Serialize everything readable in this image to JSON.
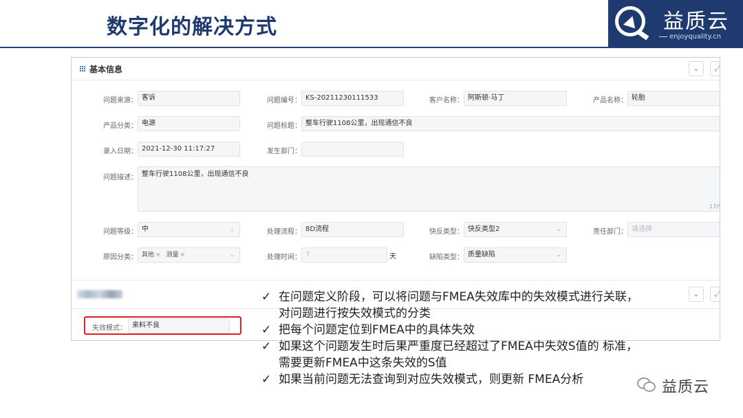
{
  "slide": {
    "title": "数字化的解决方式"
  },
  "logo": {
    "name": "益质云",
    "url_text": "enjoyquality.cn"
  },
  "panel": {
    "title": "基本信息",
    "fields": {
      "source_label": "问题来源：",
      "source_value": "客诉",
      "number_label": "问题编号：",
      "number_value": "KS-20211230111533",
      "customer_label": "客户名称：",
      "customer_value": "阿斯顿·马丁",
      "product_label": "产品名称：",
      "product_value": "轮胎",
      "category_label": "产品分类：",
      "category_value": "电源",
      "issue_title_label": "问题标题：",
      "issue_title_value": "整车行驶1108公里，出现通信不良",
      "entry_date_label": "录入日期：",
      "entry_date_value": "2021-12-30 11:17:27",
      "dept_label": "发生部门：",
      "dept_value": "",
      "desc_label": "问题描述：",
      "desc_value": "整车行驶1108公里，出现通信不良",
      "desc_counter": "17/5",
      "level_label": "问题等级：",
      "level_value": "中",
      "process_label": "处理流程：",
      "process_value": "8D流程",
      "quick_label": "快反类型：",
      "quick_value": "快反类型2",
      "owner_label": "责任部门：",
      "owner_placeholder": "请选择",
      "cause_label": "原因分类：",
      "cause_tags": [
        "其他",
        "测量"
      ],
      "time_label": "处理时间：",
      "time_value": "7",
      "time_unit": "天",
      "defect_label": "缺陷类型：",
      "defect_value": "质量缺陷"
    },
    "failure": {
      "label": "失效模式：",
      "value": "来料不良"
    }
  },
  "bullets": [
    {
      "mark": "✓",
      "lines": [
        "在问题定义阶段，可以将问题与FMEA失效库中的失效模式进行关联，",
        "对问题进行按失效模式的分类"
      ]
    },
    {
      "mark": "✓",
      "lines": [
        "把每个问题定位到FMEA中的具体失效"
      ]
    },
    {
      "mark": "✓",
      "lines": [
        "如果这个问题发生时后果严重度已经超过了FMEA中失效S值的 标准，",
        "需要更新FMEA中这条失效的S值"
      ]
    },
    {
      "mark": "✓",
      "lines": [
        "如果当前问题无法查询到对应失效模式，则更新 FMEA分析"
      ]
    }
  ],
  "watermark": {
    "text": "益质云"
  },
  "colors": {
    "title": "#1e3a6e",
    "accent": "#3a7bd5",
    "highlight": "#e02020"
  }
}
